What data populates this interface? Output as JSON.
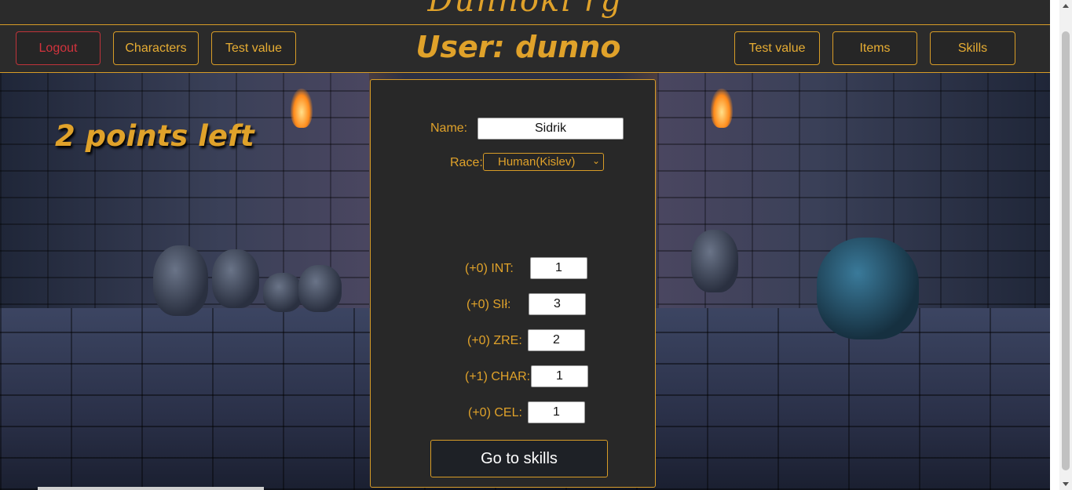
{
  "app": {
    "brand_title": "Dunnoki rg"
  },
  "navbar": {
    "logout_label": "Logout",
    "characters_label": "Characters",
    "test_value_left_label": "Test value",
    "user_title": "User: dunno",
    "test_value_right_label": "Test value",
    "items_label": "Items",
    "skills_label": "Skills"
  },
  "status": {
    "points_left": "2 points left"
  },
  "form": {
    "name_label": "Name:",
    "name_value": "Sidrik",
    "race_label": "Race:",
    "race_value": "Human(Kislev)",
    "stats": [
      {
        "label": "(+0) INT:",
        "value": "1"
      },
      {
        "label": "(+0) SIł:",
        "value": "3"
      },
      {
        "label": "(+0) ZRE:",
        "value": "2"
      },
      {
        "label": "(+1) CHAR:",
        "value": "1"
      },
      {
        "label": "(+0) CEL:",
        "value": "1"
      }
    ],
    "submit_label": "Go to skills"
  },
  "colors": {
    "accent": "#e0a22a",
    "danger": "#d2333d",
    "panel": "#282828"
  },
  "icons": {
    "select_arrow": "chevron-down-icon"
  }
}
